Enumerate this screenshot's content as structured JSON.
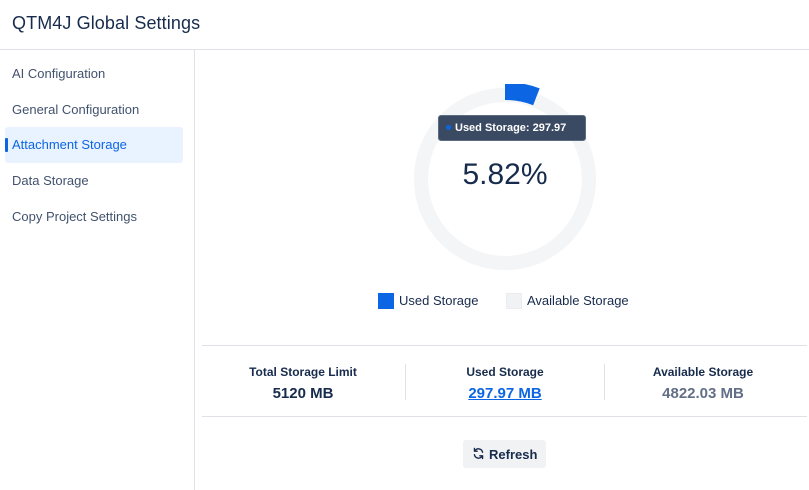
{
  "header": {
    "title": "QTM4J Global Settings"
  },
  "sidebar": {
    "items": [
      {
        "label": "AI Configuration",
        "active": false
      },
      {
        "label": "General Configuration",
        "active": false
      },
      {
        "label": "Attachment Storage",
        "active": true
      },
      {
        "label": "Data Storage",
        "active": false
      },
      {
        "label": "Copy Project Settings",
        "active": false
      }
    ]
  },
  "chart_data": {
    "type": "pie",
    "variant": "donut",
    "center_label": "5.82%",
    "slices": [
      {
        "label": "Used Storage",
        "value": 297.97,
        "color": "#0c66e4"
      },
      {
        "label": "Available Storage",
        "value": 4822.03,
        "color": "#f4f5f7"
      }
    ],
    "tooltip": "Used Storage: 297.97 MB",
    "legend": [
      "Used Storage",
      "Available Storage"
    ],
    "legend_position": "bottom"
  },
  "stats": [
    {
      "label": "Total Storage Limit",
      "value": "5120 MB"
    },
    {
      "label": "Used Storage",
      "value": "297.97 MB"
    },
    {
      "label": "Available Storage",
      "value": "4822.03 MB"
    }
  ],
  "actions": {
    "refresh_label": "Refresh"
  },
  "colors": {
    "accent": "#0c66e4",
    "track": "#f4f5f7",
    "text": "#172b4d"
  },
  "icons": {
    "refresh": "refresh-icon"
  }
}
